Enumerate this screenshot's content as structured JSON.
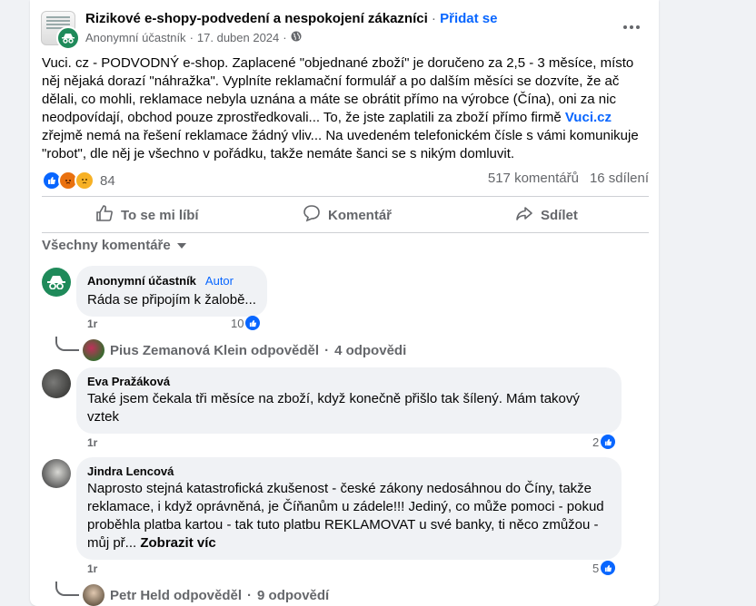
{
  "post": {
    "group_name": "Rizikové e-shopy-podvedení a nespokojení zákazníci",
    "separator": " · ",
    "join_label": "Přidat se",
    "author": "Anonymní účastník",
    "date": "17. duben 2024",
    "meta_sep": "·",
    "text_part1": "Vuci. cz - PODVODNÝ e-shop. Zaplacené  \"objednané zboží\" je doručeno za 2,5 - 3 měsíce, místo něj nějaká dorazí \"náhražka\". Vyplníte reklamační formulář a po dalším měsíci se dozvíte, že ač dělali, co mohli, reklamace nebyla uznána a máte se obrátit přímo na výrobce (Čína), oni za nic neodpovídají, obchod pouze zprostředkovali... To, že jste zaplatili za zboží přímo firmě ",
    "text_link": "Vuci.cz",
    "text_part2": " zřejmě nemá na řešení reklamace žádný vliv... Na uvedeném telefonickém čísle s vámi komunikuje \"robot\", dle něj je všechno v pořádku, takže nemáte šanci se s nikým domluvit.",
    "reaction_count": "84",
    "comments_count": "517 komentářů",
    "shares_count": "16 sdílení"
  },
  "actions": {
    "like": "To se mi líbí",
    "comment": "Komentář",
    "share": "Sdílet"
  },
  "all_comments_label": "Všechny komentáře",
  "comments": [
    {
      "name": "Anonymní účastník",
      "badge": "Autor",
      "text": "Ráda se připojím k žalobě...",
      "time": "1r",
      "likes": "10"
    },
    {
      "name": "Eva Pražáková",
      "text": "Také jsem čekala tři měsíce na zboží, když konečně přišlo tak šílený. Mám takový vztek",
      "time": "1r",
      "likes": "2"
    },
    {
      "name": "Jindra Lencová",
      "text": "Naprosto stejná katastrofická zkušenost - české zákony nedosáhnou do Číny, takže reklamace, i když oprávněná, je Číňanům u zádele!!! Jediný, co může pomoci - pokud proběhla platba kartou - tak tuto platbu REKLAMOVAT u své banky, ti něco zmůžou - můj př...",
      "see_more": "Zobrazit víc",
      "time": "1r",
      "likes": "5"
    }
  ],
  "replies": [
    {
      "text": "Pius Zemanová Klein odpověděl",
      "sep": "·",
      "count": "4 odpovědi"
    },
    {
      "text": "Petr Held odpověděl",
      "sep": "·",
      "count": "9 odpovědí"
    }
  ],
  "colors": {
    "accent": "#0866ff",
    "anon_green": "#1f8a5a",
    "muted": "#65676b"
  }
}
